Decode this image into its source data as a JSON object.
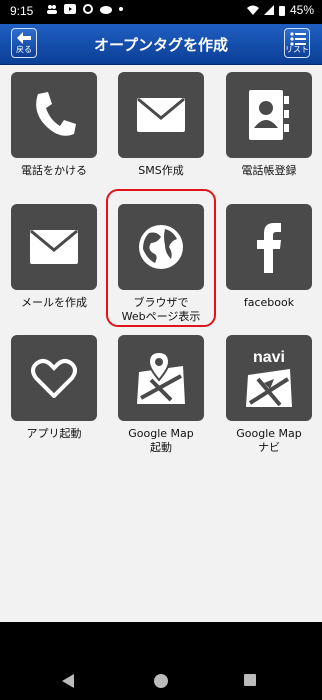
{
  "status_bar": {
    "time": "9:15",
    "battery": "45%"
  },
  "header": {
    "title": "オープンタグを作成",
    "back_label": "戻る",
    "list_label": "リスト"
  },
  "tiles": [
    {
      "label": "電話をかける",
      "icon": "phone-icon"
    },
    {
      "label": "SMS作成",
      "icon": "mail-icon"
    },
    {
      "label": "電話帳登録",
      "icon": "contacts-icon"
    },
    {
      "label": "メールを作成",
      "icon": "mail-icon"
    },
    {
      "label": "ブラウザで\nWebページ表示",
      "icon": "globe-icon"
    },
    {
      "label": "facebook",
      "icon": "facebook-icon"
    },
    {
      "label": "アプリ起動",
      "icon": "heart-icon"
    },
    {
      "label": "Google Map\n起動",
      "icon": "map-icon"
    },
    {
      "label": "Google Map\nナビ",
      "icon": "navi-map-icon",
      "badge": "navi"
    }
  ],
  "colors": {
    "header": "#0b3f96",
    "tile": "#4a4a4a",
    "highlight": "#e0141a"
  }
}
